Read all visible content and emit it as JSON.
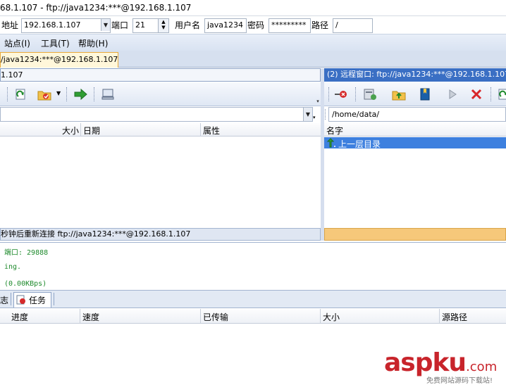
{
  "window": {
    "title": "68.1.107 - ftp://java1234:***@192.168.1.107"
  },
  "connection": {
    "address_label": "地址",
    "address_value": "192.168.1.107",
    "port_label": "端口",
    "port_value": "21",
    "user_label": "用户名",
    "user_value": "java1234",
    "password_label": "密码",
    "password_value": "*********",
    "path_label": "路径",
    "path_value": "/"
  },
  "menu": {
    "items": [
      "站点(I)",
      "工具(T)",
      "帮助(H)"
    ]
  },
  "tabs": [
    {
      "label": "/java1234:***@192.168.1.107"
    }
  ],
  "local": {
    "title": "1.107",
    "columns": [
      "大小",
      "日期",
      "属性"
    ],
    "status": "秒钟后重新连接 ftp://java1234:***@192.168.1.107"
  },
  "remote": {
    "title": "(2) 远程窗口: ftp://java1234:***@192.168.1.107",
    "path": "/home/data/",
    "columns": [
      "名字"
    ],
    "rows": [
      {
        "name": "上一层目录"
      }
    ]
  },
  "log": {
    "lines": [
      "端口: 29888",
      "ing.",
      "(0.00KBps)"
    ]
  },
  "queue": {
    "tabs": [
      "志",
      "任务"
    ],
    "columns": [
      "进度",
      "速度",
      "已传输",
      "大小",
      "源路径"
    ]
  },
  "watermark": {
    "main": "aspku",
    "suffix": ".com",
    "sub": "免费网站源码下载站!"
  },
  "colors": {
    "accent": "#3a6fc4",
    "selection": "#3d80df",
    "watermark": "#c8242b"
  }
}
